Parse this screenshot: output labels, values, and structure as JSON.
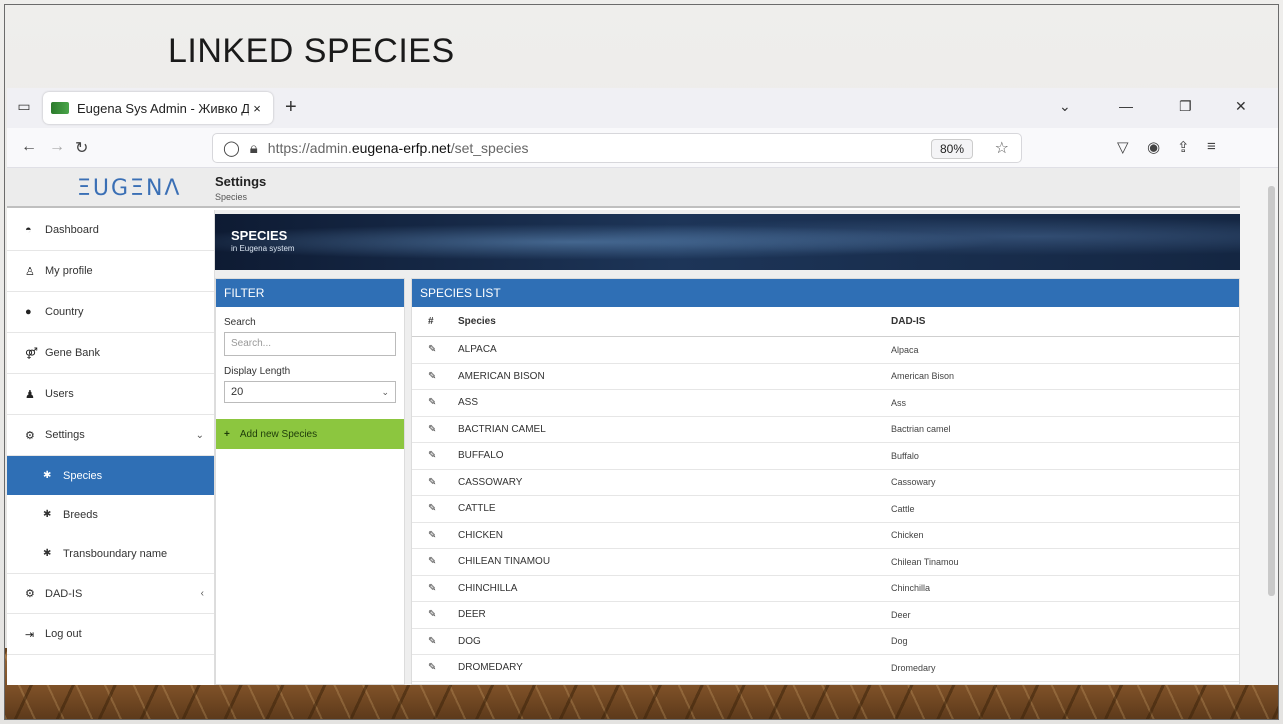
{
  "slide": {
    "title": "LINKED SPECIES"
  },
  "browser": {
    "tab_title": "Eugena Sys Admin - Живко Дул",
    "tab_close": "×",
    "new_tab": "+",
    "url_prefix": "https://admin.",
    "url_host": "eugena-erfp.net",
    "url_path": "/set_species",
    "zoom": "80%"
  },
  "app": {
    "logo": "ΞUGΞNΛ",
    "breadcrumb_title": "Settings",
    "breadcrumb_sub": "Species"
  },
  "sidebar": {
    "items": [
      {
        "label": "Dashboard",
        "icon": "dashboard-icon"
      },
      {
        "label": "My profile",
        "icon": "user-icon"
      },
      {
        "label": "Country",
        "icon": "globe-icon"
      },
      {
        "label": "Gene Bank",
        "icon": "gene-icon"
      },
      {
        "label": "Users",
        "icon": "users-icon"
      },
      {
        "label": "Settings",
        "icon": "cogs-icon"
      }
    ],
    "sub_items": [
      {
        "label": "Species"
      },
      {
        "label": "Breeds"
      },
      {
        "label": "Transboundary name"
      }
    ],
    "bottom": [
      {
        "label": "DAD-IS",
        "icon": "cogs-icon"
      },
      {
        "label": "Log out",
        "icon": "logout-icon"
      }
    ]
  },
  "banner": {
    "title": "SPECIES",
    "subtitle": "in Eugena system"
  },
  "filter": {
    "heading": "FILTER",
    "search_label": "Search",
    "search_placeholder": "Search...",
    "length_label": "Display Length",
    "length_value": "20",
    "add_button": "Add new Species"
  },
  "species_list": {
    "heading": "SPECIES LIST",
    "columns": [
      "#",
      "Species",
      "DAD-IS"
    ],
    "rows": [
      {
        "species": "ALPACA",
        "dadis": "Alpaca"
      },
      {
        "species": "AMERICAN BISON",
        "dadis": "American Bison"
      },
      {
        "species": "ASS",
        "dadis": "Ass"
      },
      {
        "species": "BACTRIAN CAMEL",
        "dadis": "Bactrian camel"
      },
      {
        "species": "BUFFALO",
        "dadis": "Buffalo"
      },
      {
        "species": "CASSOWARY",
        "dadis": "Cassowary"
      },
      {
        "species": "CATTLE",
        "dadis": "Cattle"
      },
      {
        "species": "CHICKEN",
        "dadis": "Chicken"
      },
      {
        "species": "CHILEAN TINAMOU",
        "dadis": "Chilean Tinamou"
      },
      {
        "species": "CHINCHILLA",
        "dadis": "Chinchilla"
      },
      {
        "species": "DEER",
        "dadis": "Deer"
      },
      {
        "species": "DOG",
        "dadis": "Dog"
      },
      {
        "species": "DROMEDARY",
        "dadis": "Dromedary"
      }
    ]
  },
  "colors": {
    "accent": "#2f6fb5",
    "add_button": "#8cc63f"
  }
}
